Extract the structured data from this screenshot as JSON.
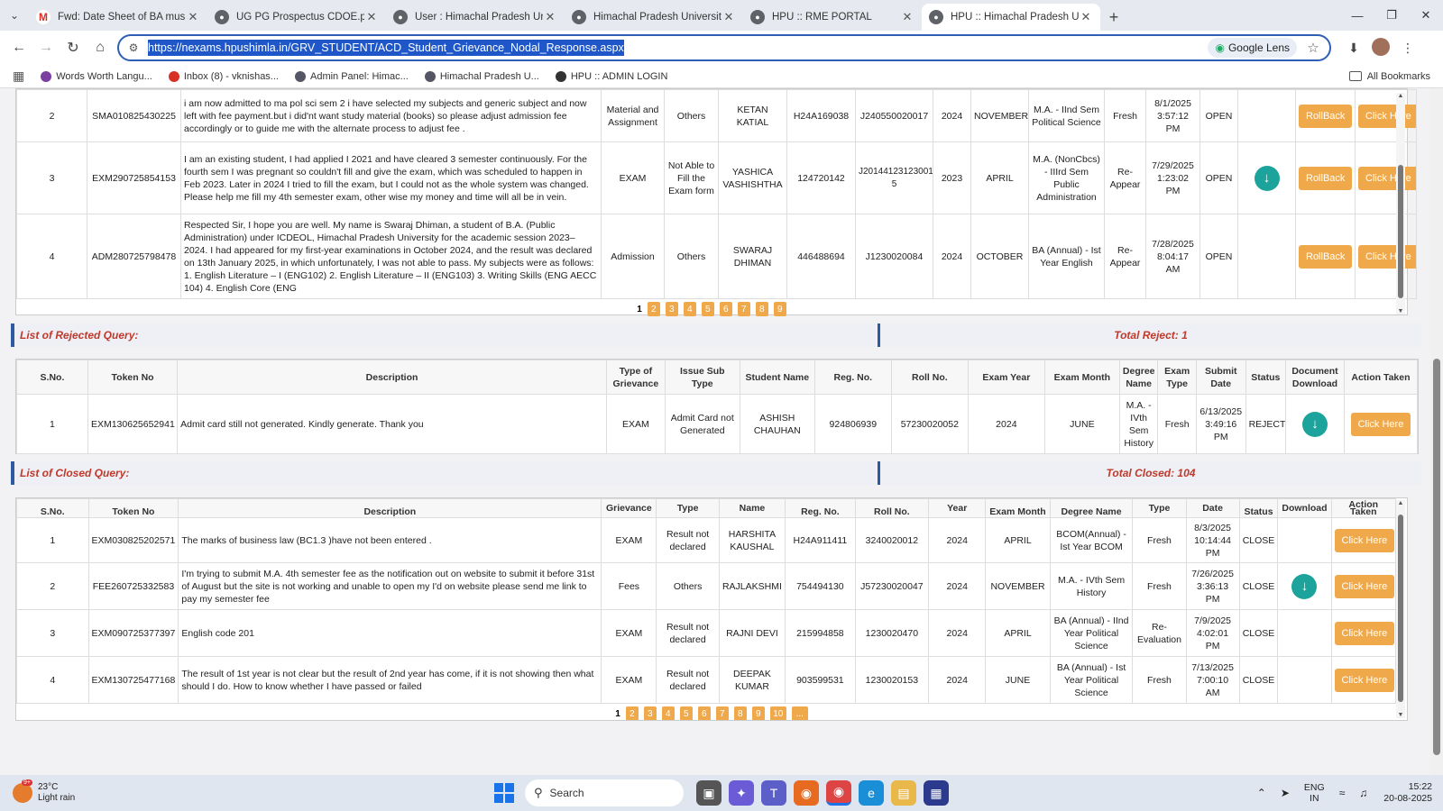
{
  "browser": {
    "tabs": [
      {
        "title": "Fwd: Date Sheet of BA music Pr",
        "icon": "gmail-icon"
      },
      {
        "title": "UG PG Prospectus CDOE.pdf",
        "icon": "globe-icon"
      },
      {
        "title": "User : Himachal Pradesh Univer",
        "icon": "hpu-icon"
      },
      {
        "title": "Himachal Pradesh University",
        "icon": "hpu-icon"
      },
      {
        "title": "HPU :: RME PORTAL",
        "icon": "globe-icon"
      },
      {
        "title": "HPU :: Himachal Pradesh Univer",
        "icon": "hpu-icon"
      }
    ],
    "url": "https://nexams.hpushimla.in/GRV_STUDENT/ACD_Student_Grievance_Nodal_Response.aspx",
    "lens_label": "Google Lens",
    "bookmarks": [
      "Words Worth Langu...",
      "Inbox (8) - vknishas...",
      "Admin Panel: Himac...",
      "Himachal Pradesh U...",
      "HPU :: ADMIN LOGIN"
    ],
    "all_bookmarks": "All Bookmarks"
  },
  "open_query": {
    "rows": [
      {
        "sno": "2",
        "token": "SMA010825430225",
        "desc": "i am now admitted to ma pol sci sem 2 i have selected my subjects and generic subject and now left with fee payment.but i did'nt want study material (books) so please adjust admission fee accordingly or to guide me with the alternate process to adjust fee .",
        "type": "Material and Assignment",
        "sub": "Others",
        "name": "KETAN KATIAL",
        "reg": "H24A169038",
        "roll": "J240550020017",
        "year": "2024",
        "month": "NOVEMBER",
        "degree": "M.A. - IInd Sem Political Science",
        "etype": "Fresh",
        "date": "8/1/2025 3:57:12 PM",
        "status": "OPEN",
        "doc": false
      },
      {
        "sno": "3",
        "token": "EXM290725854153",
        "desc": "I am an existing student, I had applied I 2021 and have cleared 3 semester continuously. For the fourth sem I was pregnant so couldn't fill and give the exam, which was scheduled to happen in Feb 2023. Later in 2024 I tried to fill the exam, but I could not as the whole system was changed. Please help me fill my 4th semester exam, other wise my money and time will all be in vein.",
        "type": "EXAM",
        "sub": "Not Able to Fill the Exam form",
        "name": "YASHICA VASHISHTHA",
        "reg": "124720142",
        "roll": "J20144123123001​5",
        "year": "2023",
        "month": "APRIL",
        "degree": "M.A. (NonCbcs) - IIIrd Sem Public Administration",
        "etype": "Re-Appear",
        "date": "7/29/2025 1:23:02 PM",
        "status": "OPEN",
        "doc": true
      },
      {
        "sno": "4",
        "token": "ADM280725798478",
        "desc": "Respected Sir, I hope you are well. My name is Swaraj Dhiman, a student of B.A. (Public Administration) under ICDEOL, Himachal Pradesh University for the academic session 2023–2024. I had appeared for my first-year examinations in October 2024, and the result was declared on 13th January 2025, in which unfortunately, I was not able to pass. My subjects were as follows: 1. English Literature – I (ENG102) 2. English Literature – II (ENG103) 3. Writing Skills (ENG AECC 104) 4. English Core (ENG",
        "type": "Admission",
        "sub": "Others",
        "name": "SWARAJ DHIMAN",
        "reg": "446488694",
        "roll": "J1230020084",
        "year": "2024",
        "month": "OCTOBER",
        "degree": "BA (Annual) - Ist Year English",
        "etype": "Re-Appear",
        "date": "7/28/2025 8:04:17 AM",
        "status": "OPEN",
        "doc": false
      }
    ],
    "rollback_label": "RollBack",
    "action_label": "Click Here",
    "pages": [
      "1",
      "2",
      "3",
      "4",
      "5",
      "6",
      "7",
      "8",
      "9"
    ]
  },
  "rejected": {
    "title": "List of Rejected Query:",
    "total": "Total Reject: 1",
    "headers": [
      "S.No.",
      "Token No",
      "Description",
      "Type of Grievance",
      "Issue Sub Type",
      "Student Name",
      "Reg. No.",
      "Roll No.",
      "Exam Year",
      "Exam Month",
      "Degree Name",
      "Exam Type",
      "Submit Date",
      "Status",
      "Document Download",
      "Action Taken"
    ],
    "rows": [
      {
        "sno": "1",
        "token": "EXM130625652941",
        "desc": "Admit card still not generated. Kindly generate. Thank you",
        "type": "EXAM",
        "sub": "Admit Card not Generated",
        "name": "ASHISH CHAUHAN",
        "reg": "924806939",
        "roll": "57230020052",
        "year": "2024",
        "month": "JUNE",
        "degree": "M.A. - IVth Sem History",
        "etype": "Fresh",
        "date": "6/13/2025 3:49:16 PM",
        "status": "REJECT"
      }
    ],
    "action_label": "Click Here"
  },
  "closed": {
    "title": "List of Closed Query:",
    "total": "Total Closed: 104",
    "headers": [
      "S.No.",
      "Token No",
      "Description",
      "Grievance",
      "Type",
      "Name",
      "Reg. No.",
      "Roll No.",
      "Year",
      "Exam Month",
      "Degree Name",
      "Type",
      "Date",
      "Status",
      "Download",
      "Action Taken"
    ],
    "rows": [
      {
        "sno": "1",
        "token": "EXM030825202571",
        "desc": "The marks of business law (BC1.3 )have not been entered .",
        "type": "EXAM",
        "sub": "Result not declared",
        "name": "HARSHITA KAUSHAL",
        "reg": "H24A911411",
        "roll": "3240020012",
        "year": "2024",
        "month": "APRIL",
        "degree": "BCOM(Annual) - Ist Year BCOM",
        "etype": "Fresh",
        "date": "8/3/2025 10:14:44 PM",
        "status": "CLOSE",
        "doc": false
      },
      {
        "sno": "2",
        "token": "FEE260725332583",
        "desc": "I'm trying to submit M.A. 4th semester fee as the notification out on website to submit it before 31st of August but the site is not working and unable to open my I'd on website please send me link to pay my semester fee",
        "type": "Fees",
        "sub": "Others",
        "name": "RAJLAKSHMI",
        "reg": "754494130",
        "roll": "J57230020047",
        "year": "2024",
        "month": "NOVEMBER",
        "degree": "M.A. - IVth Sem History",
        "etype": "Fresh",
        "date": "7/26/2025 3:36:13 PM",
        "status": "CLOSE",
        "doc": true
      },
      {
        "sno": "3",
        "token": "EXM090725377397",
        "desc": "English code 201",
        "type": "EXAM",
        "sub": "Result not declared",
        "name": "RAJNI DEVI",
        "reg": "215994858",
        "roll": "1230020470",
        "year": "2024",
        "month": "APRIL",
        "degree": "BA (Annual) - IInd Year Political Science",
        "etype": "Re-Evaluation",
        "date": "7/9/2025 4:02:01 PM",
        "status": "CLOSE",
        "doc": false
      },
      {
        "sno": "4",
        "token": "EXM130725477168",
        "desc": "The result of 1st year is not clear but the result of 2nd year has come, if it is not showing then what should I do. How to know whether I have passed or failed",
        "type": "EXAM",
        "sub": "Result not declared",
        "name": "DEEPAK KUMAR",
        "reg": "903599531",
        "roll": "1230020153",
        "year": "2024",
        "month": "JUNE",
        "degree": "BA (Annual) - Ist Year Political Science",
        "etype": "Fresh",
        "date": "7/13/2025 7:00:10 AM",
        "status": "CLOSE",
        "doc": false
      }
    ],
    "action_label": "Click Here",
    "pages": [
      "1",
      "2",
      "3",
      "4",
      "5",
      "6",
      "7",
      "8",
      "9",
      "10",
      "..."
    ]
  },
  "taskbar": {
    "temp": "23°C",
    "weather": "Light rain",
    "search_label": "Search",
    "lang1": "ENG",
    "lang2": "IN",
    "time": "15:22",
    "date": "20-08-2025",
    "weather_badge": "9+"
  },
  "colors": {
    "accent": "#f0a94a",
    "section_title": "#c0392b",
    "download": "#1ba39c"
  }
}
